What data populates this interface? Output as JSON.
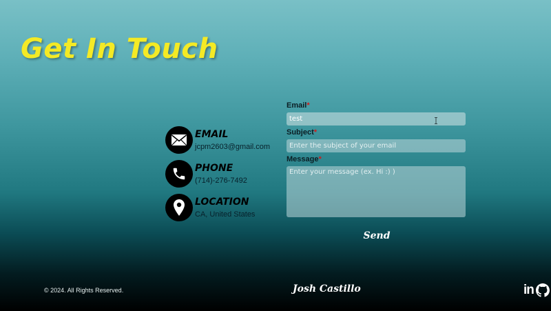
{
  "heading": {
    "title": "Get In Touch"
  },
  "contact": {
    "items": [
      {
        "label": "EMAIL",
        "value": "jcpm2603@gmail.com",
        "icon": "envelope-icon"
      },
      {
        "label": "PHONE",
        "value": "(714)-276-7492",
        "icon": "phone-icon"
      },
      {
        "label": "LOCATION",
        "value": "CA, United States",
        "icon": "location-pin-icon"
      }
    ]
  },
  "form": {
    "email": {
      "label": "Email",
      "required_mark": "*",
      "value": "test",
      "placeholder": ""
    },
    "subject": {
      "label": "Subject",
      "required_mark": "*",
      "value": "",
      "placeholder": "Enter the subject of your email"
    },
    "message": {
      "label": "Message",
      "required_mark": "*",
      "value": "",
      "placeholder": "Enter your message (ex. Hi :) )"
    },
    "send_label": "Send"
  },
  "footer": {
    "copyright": "© 2024. All Rights Reserved.",
    "name": "Josh Castillo",
    "social": [
      {
        "icon": "linkedin-icon",
        "text": "in"
      },
      {
        "icon": "github-icon"
      }
    ]
  },
  "colors": {
    "title_yellow": "#f4ea25",
    "required_red": "#d11a1a",
    "icon_circle": "#000000",
    "background_top": "#79c0c6",
    "background_bottom": "#000000"
  }
}
